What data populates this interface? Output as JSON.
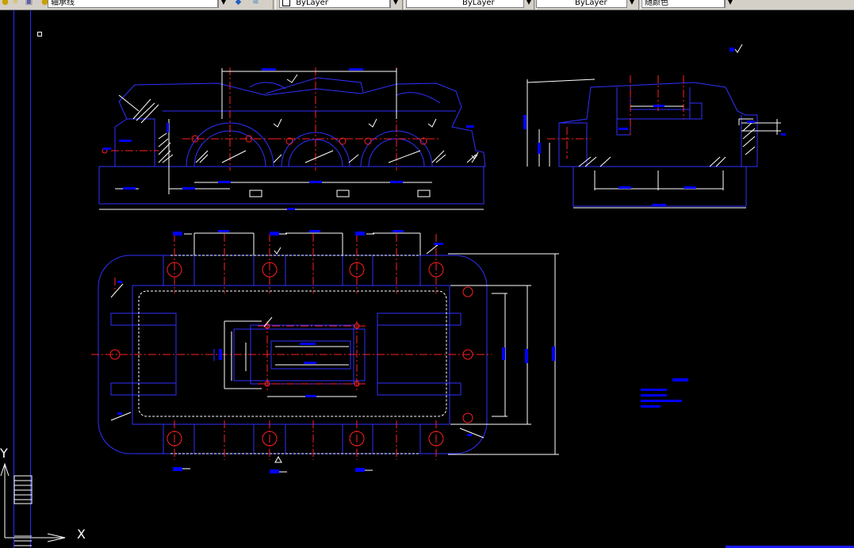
{
  "toolbar": {
    "layer_name": "轴承线",
    "color": "ByLayer",
    "linetype": "ByLayer",
    "lineweight": "ByLayer",
    "plotstyle": "随颜色",
    "dropdown_arrow": "▼"
  },
  "ucs": {
    "y_label": "Y",
    "x_label": "X"
  },
  "colors": {
    "background": "#000000",
    "outline": "#3030ff",
    "center_line": "#ff2020",
    "dimension": "#ffffff",
    "hatch": "#ffffff",
    "dim_text": "#0000ff"
  },
  "icons": [
    "lightbulb-icon",
    "sun-icon",
    "lock-icon",
    "layer-icon",
    "layer-stack-icon",
    "color-swatch-icon"
  ]
}
